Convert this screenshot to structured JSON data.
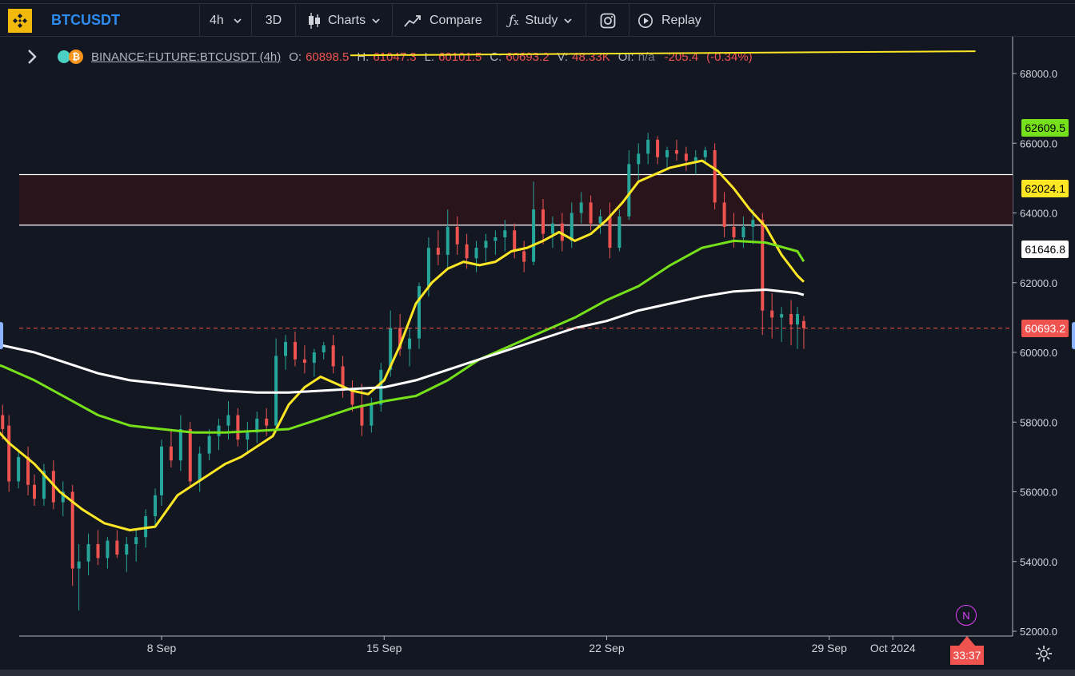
{
  "toolbar": {
    "symbol": "BTCUSDT",
    "interval": "4h",
    "mode_3d": "3D",
    "charts": "Charts",
    "compare": "Compare",
    "study": "Study",
    "replay": "Replay"
  },
  "legend": {
    "ticker": "BINANCE:FUTURE:BTCUSDT (4h)",
    "o_label": "O:",
    "o_value": "60898.5",
    "h_label": "H:",
    "h_value": "61047.3",
    "l_label": "L:",
    "l_value": "60101.5",
    "c_label": "C:",
    "c_value": "60693.2",
    "v_label": "V:",
    "v_value": "48.33K",
    "oi_label": "OI:",
    "oi_value": "n/a",
    "change": "-205.4",
    "change_pct": "(-0.34%)"
  },
  "price_labels": {
    "green": "62609.5",
    "yellow": "62024.1",
    "white": "61646.8",
    "last": "60693.2",
    "countdown": "33:37"
  },
  "marker": "N",
  "colors": {
    "background": "#131722",
    "up": "#26a69a",
    "down": "#ef5350",
    "ma_fast": "#fde725",
    "ma_mid": "#76e01b",
    "ma_slow": "#ffffff",
    "zone_fill": "#2a141c",
    "marker": "#e040fb"
  },
  "chart_data": {
    "type": "candlestick",
    "y_axis": {
      "min": 52000,
      "max": 68800,
      "ticks": [
        52000,
        54000,
        56000,
        58000,
        60000,
        62000,
        64000,
        66000,
        68000
      ]
    },
    "x_axis": {
      "labels": [
        "8 Sep",
        "15 Sep",
        "22 Sep",
        "29 Sep",
        "Oct 2024"
      ],
      "label_days": [
        6,
        13,
        20,
        27,
        29
      ],
      "range_days": [
        0,
        31.6
      ]
    },
    "price_zone": {
      "low": 63650,
      "high": 65100
    },
    "last_price": 60693.2,
    "trend_line": {
      "from": [
        22,
        68750
      ],
      "to": [
        31.6,
        68640
      ]
    },
    "series": [
      {
        "name": "ma_fast",
        "color": "#fde725",
        "points": [
          [
            0,
            58600
          ],
          [
            0.5,
            58100
          ],
          [
            1.2,
            57400
          ],
          [
            2.0,
            56800
          ],
          [
            2.8,
            56000
          ],
          [
            3.5,
            55500
          ],
          [
            4.2,
            55100
          ],
          [
            5.0,
            54900
          ],
          [
            5.8,
            55000
          ],
          [
            6.5,
            55900
          ],
          [
            7.0,
            56200
          ],
          [
            7.5,
            56500
          ],
          [
            8.0,
            56800
          ],
          [
            8.5,
            57000
          ],
          [
            9.0,
            57300
          ],
          [
            9.5,
            57600
          ],
          [
            10.0,
            58500
          ],
          [
            10.5,
            59000
          ],
          [
            11.0,
            59300
          ],
          [
            11.5,
            59100
          ],
          [
            12.0,
            58900
          ],
          [
            12.5,
            58800
          ],
          [
            13.0,
            59200
          ],
          [
            13.5,
            60200
          ],
          [
            14.0,
            61400
          ],
          [
            14.5,
            62000
          ],
          [
            15.0,
            62400
          ],
          [
            15.5,
            62600
          ],
          [
            16.0,
            62500
          ],
          [
            16.5,
            62600
          ],
          [
            17.0,
            62900
          ],
          [
            17.5,
            63000
          ],
          [
            18.0,
            63200
          ],
          [
            18.5,
            63450
          ],
          [
            19.0,
            63200
          ],
          [
            19.5,
            63400
          ],
          [
            20.0,
            63800
          ],
          [
            20.5,
            64300
          ],
          [
            21.0,
            64900
          ],
          [
            21.5,
            65100
          ],
          [
            22.0,
            65300
          ],
          [
            22.5,
            65400
          ],
          [
            23.0,
            65500
          ],
          [
            23.5,
            65200
          ],
          [
            24.0,
            64700
          ],
          [
            24.5,
            64100
          ],
          [
            25.0,
            63600
          ],
          [
            25.5,
            62800
          ],
          [
            26.0,
            62200
          ],
          [
            26.2,
            62024
          ]
        ]
      },
      {
        "name": "ma_mid",
        "color": "#76e01b",
        "points": [
          [
            0,
            59900
          ],
          [
            1,
            59600
          ],
          [
            2,
            59200
          ],
          [
            3,
            58700
          ],
          [
            4,
            58200
          ],
          [
            5,
            57900
          ],
          [
            6,
            57800
          ],
          [
            7,
            57700
          ],
          [
            8,
            57700
          ],
          [
            9,
            57750
          ],
          [
            10,
            57800
          ],
          [
            11,
            58100
          ],
          [
            12,
            58400
          ],
          [
            13,
            58600
          ],
          [
            14,
            58750
          ],
          [
            15,
            59200
          ],
          [
            16,
            59800
          ],
          [
            17,
            60200
          ],
          [
            18,
            60600
          ],
          [
            19,
            61000
          ],
          [
            20,
            61500
          ],
          [
            21,
            61900
          ],
          [
            22,
            62500
          ],
          [
            23,
            63000
          ],
          [
            24,
            63200
          ],
          [
            25,
            63150
          ],
          [
            26,
            62900
          ],
          [
            26.2,
            62609
          ]
        ]
      },
      {
        "name": "ma_slow",
        "color": "#ffffff",
        "points": [
          [
            0,
            60500
          ],
          [
            1,
            60200
          ],
          [
            2,
            60000
          ],
          [
            3,
            59700
          ],
          [
            4,
            59400
          ],
          [
            5,
            59200
          ],
          [
            6,
            59100
          ],
          [
            7,
            59000
          ],
          [
            8,
            58900
          ],
          [
            9,
            58850
          ],
          [
            10,
            58850
          ],
          [
            11,
            58900
          ],
          [
            12,
            58950
          ],
          [
            13,
            59000
          ],
          [
            14,
            59200
          ],
          [
            15,
            59500
          ],
          [
            16,
            59800
          ],
          [
            17,
            60100
          ],
          [
            18,
            60400
          ],
          [
            19,
            60700
          ],
          [
            20,
            60900
          ],
          [
            21,
            61200
          ],
          [
            22,
            61400
          ],
          [
            23,
            61600
          ],
          [
            24,
            61750
          ],
          [
            25,
            61800
          ],
          [
            26,
            61700
          ],
          [
            26.2,
            61647
          ]
        ]
      }
    ],
    "candles": [
      [
        0,
        58200,
        58600,
        57800,
        58300
      ],
      [
        0.3,
        58300,
        58400,
        57000,
        57200
      ],
      [
        0.5,
        57100,
        57400,
        56500,
        56800
      ],
      [
        0.7,
        56900,
        58400,
        56700,
        58300
      ],
      [
        1.0,
        58200,
        58500,
        57500,
        57800
      ],
      [
        1.2,
        57900,
        58200,
        56000,
        56300
      ],
      [
        1.5,
        56300,
        57200,
        56100,
        57000
      ],
      [
        1.8,
        57000,
        57300,
        55900,
        56200
      ],
      [
        2.0,
        56200,
        56500,
        55600,
        55800
      ],
      [
        2.3,
        55800,
        56800,
        55600,
        56600
      ],
      [
        2.6,
        56600,
        56900,
        55500,
        55700
      ],
      [
        2.9,
        55700,
        56300,
        55300,
        56000
      ],
      [
        3.2,
        56000,
        56200,
        53300,
        53800
      ],
      [
        3.4,
        53800,
        54500,
        52600,
        54000
      ],
      [
        3.7,
        54000,
        54800,
        53600,
        54500
      ],
      [
        4.0,
        54500,
        54900,
        53900,
        54100
      ],
      [
        4.3,
        54100,
        54700,
        53800,
        54600
      ],
      [
        4.6,
        54600,
        54900,
        54100,
        54200
      ],
      [
        4.9,
        54200,
        54700,
        53700,
        54500
      ],
      [
        5.2,
        54500,
        54900,
        54000,
        54700
      ],
      [
        5.5,
        54700,
        55500,
        54400,
        55300
      ],
      [
        5.8,
        55300,
        56100,
        55000,
        55900
      ],
      [
        6.0,
        55900,
        57500,
        55600,
        57300
      ],
      [
        6.3,
        57300,
        57800,
        56700,
        56900
      ],
      [
        6.6,
        56900,
        58200,
        56600,
        57800
      ],
      [
        6.9,
        57800,
        58000,
        56100,
        56300
      ],
      [
        7.2,
        56300,
        57300,
        56000,
        57100
      ],
      [
        7.5,
        57100,
        57800,
        56900,
        57600
      ],
      [
        7.8,
        57600,
        58100,
        57200,
        57900
      ],
      [
        8.1,
        57900,
        58600,
        57500,
        58200
      ],
      [
        8.4,
        58200,
        58400,
        57300,
        57500
      ],
      [
        8.7,
        57500,
        58000,
        57100,
        57700
      ],
      [
        9.0,
        57700,
        58300,
        57400,
        58100
      ],
      [
        9.3,
        58100,
        58400,
        57600,
        57900
      ],
      [
        9.6,
        57900,
        60400,
        57700,
        59900
      ],
      [
        9.9,
        59900,
        60500,
        59500,
        60300
      ],
      [
        10.2,
        60300,
        60600,
        59600,
        59800
      ],
      [
        10.5,
        59800,
        60200,
        59400,
        59700
      ],
      [
        10.8,
        59700,
        60100,
        59300,
        60000
      ],
      [
        11.1,
        60000,
        60300,
        59800,
        60200
      ],
      [
        11.4,
        60200,
        60500,
        59400,
        59600
      ],
      [
        11.7,
        59600,
        59900,
        58700,
        58900
      ],
      [
        12.0,
        58900,
        59200,
        58300,
        58500
      ],
      [
        12.3,
        58500,
        59100,
        57600,
        57900
      ],
      [
        12.6,
        57900,
        58700,
        57700,
        58500
      ],
      [
        12.9,
        58500,
        59700,
        58300,
        59500
      ],
      [
        13.2,
        59500,
        61200,
        59300,
        60700
      ],
      [
        13.5,
        60700,
        61100,
        59900,
        60100
      ],
      [
        13.8,
        60100,
        60700,
        59600,
        60400
      ],
      [
        14.1,
        60400,
        62000,
        60100,
        61900
      ],
      [
        14.4,
        61900,
        63300,
        61600,
        63000
      ],
      [
        14.7,
        63000,
        63500,
        62500,
        62800
      ],
      [
        15.0,
        62800,
        64100,
        62400,
        63600
      ],
      [
        15.3,
        63600,
        63900,
        62800,
        63100
      ],
      [
        15.6,
        63100,
        63400,
        62400,
        62700
      ],
      [
        15.9,
        62700,
        63200,
        62300,
        63000
      ],
      [
        16.2,
        63000,
        63400,
        62600,
        63200
      ],
      [
        16.5,
        63200,
        63500,
        62800,
        63300
      ],
      [
        16.8,
        63300,
        63800,
        62900,
        63500
      ],
      [
        17.1,
        63500,
        63700,
        62700,
        62900
      ],
      [
        17.4,
        62900,
        63200,
        62300,
        62600
      ],
      [
        17.7,
        62600,
        64900,
        62500,
        64100
      ],
      [
        18.0,
        64100,
        64400,
        63100,
        63400
      ],
      [
        18.3,
        63400,
        63900,
        63000,
        63700
      ],
      [
        18.6,
        63700,
        64000,
        62900,
        63200
      ],
      [
        18.9,
        63200,
        64300,
        63000,
        64000
      ],
      [
        19.2,
        64000,
        64600,
        63700,
        64300
      ],
      [
        19.5,
        64300,
        64500,
        63500,
        63700
      ],
      [
        19.8,
        63700,
        64100,
        63400,
        63900
      ],
      [
        20.1,
        63900,
        64300,
        62700,
        63000
      ],
      [
        20.4,
        63000,
        64100,
        62900,
        63900
      ],
      [
        20.7,
        63900,
        65800,
        63800,
        65400
      ],
      [
        21.0,
        65400,
        66000,
        64900,
        65700
      ],
      [
        21.3,
        65700,
        66300,
        65400,
        66100
      ],
      [
        21.6,
        66100,
        66200,
        65400,
        65600
      ],
      [
        21.9,
        65600,
        65900,
        65300,
        65800
      ],
      [
        22.2,
        65800,
        66100,
        65500,
        65700
      ],
      [
        22.5,
        65700,
        65900,
        65200,
        65500
      ],
      [
        22.8,
        65500,
        65800,
        65100,
        65600
      ],
      [
        23.1,
        65600,
        65900,
        65400,
        65800
      ],
      [
        23.4,
        65800,
        66000,
        64100,
        64300
      ],
      [
        23.7,
        64300,
        64600,
        63300,
        63600
      ],
      [
        24.0,
        63600,
        64000,
        63000,
        63300
      ],
      [
        24.3,
        63300,
        63900,
        63000,
        63600
      ],
      [
        24.6,
        63600,
        64100,
        63100,
        63800
      ],
      [
        24.9,
        63800,
        64000,
        60500,
        61200
      ],
      [
        25.2,
        61200,
        61700,
        60400,
        61000
      ],
      [
        25.5,
        61000,
        61300,
        60300,
        61100
      ],
      [
        25.8,
        61100,
        61500,
        60200,
        60800
      ],
      [
        26.0,
        60800,
        61300,
        60100,
        61100
      ],
      [
        26.2,
        60899,
        61047,
        60101,
        60693
      ]
    ]
  }
}
